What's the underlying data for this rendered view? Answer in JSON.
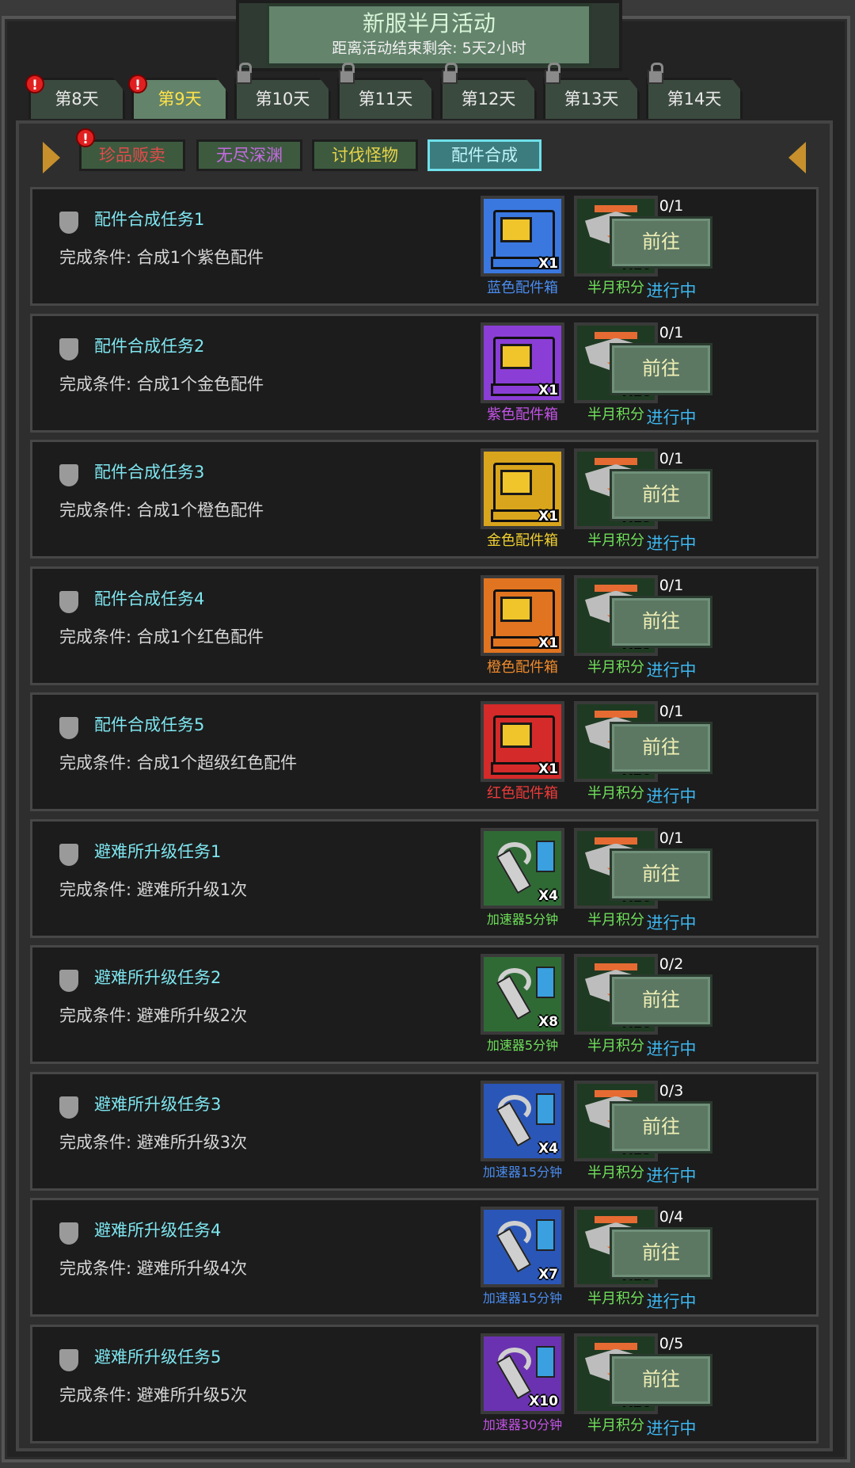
{
  "header": {
    "title": "新服半月活动",
    "countdown": "距离活动结束剩余: 5天2小时"
  },
  "day_tabs": [
    {
      "label": "第8天",
      "alert": "!",
      "locked": false,
      "active": false
    },
    {
      "label": "第9天",
      "alert": "!",
      "locked": false,
      "active": true
    },
    {
      "label": "第10天",
      "locked": true,
      "active": false
    },
    {
      "label": "第11天",
      "locked": true,
      "active": false
    },
    {
      "label": "第12天",
      "locked": true,
      "active": false
    },
    {
      "label": "第13天",
      "locked": true,
      "active": false
    },
    {
      "label": "第14天",
      "locked": true,
      "active": false
    }
  ],
  "sub_tabs": [
    {
      "label": "珍品贩卖",
      "alert": "!",
      "color": "#e34b4b",
      "bg": "#3d5a3f",
      "active": false
    },
    {
      "label": "无尽深渊",
      "color": "#c46be0",
      "bg": "#3d5a3f",
      "active": false
    },
    {
      "label": "讨伐怪物",
      "color": "#e8d44a",
      "bg": "#3d5a3f",
      "active": false
    },
    {
      "label": "配件合成",
      "color": "#a5e9f0",
      "bg": "#3c7b7e",
      "active": true
    }
  ],
  "tasks": [
    {
      "name": "配件合成任务1",
      "condition": "完成条件: 合成1个紫色配件",
      "reward1": {
        "label": "蓝色配件箱",
        "qty": "X1",
        "type": "crate",
        "color": "#3a78e0",
        "labelColor": "#4a8cf0"
      },
      "reward2": {
        "label": "半月积分",
        "qty": "X10",
        "labelColor": "#6ee05a"
      },
      "progress": "0/1",
      "button": "前往",
      "status": "进行中"
    },
    {
      "name": "配件合成任务2",
      "condition": "完成条件: 合成1个金色配件",
      "reward1": {
        "label": "紫色配件箱",
        "qty": "X1",
        "type": "crate",
        "color": "#8a3ed6",
        "labelColor": "#c453e8"
      },
      "reward2": {
        "label": "半月积分",
        "qty": "X10",
        "labelColor": "#6ee05a"
      },
      "progress": "0/1",
      "button": "前往",
      "status": "进行中"
    },
    {
      "name": "配件合成任务3",
      "condition": "完成条件: 合成1个橙色配件",
      "reward1": {
        "label": "金色配件箱",
        "qty": "X1",
        "type": "crate",
        "color": "#d9a51c",
        "labelColor": "#f0d030"
      },
      "reward2": {
        "label": "半月积分",
        "qty": "X15",
        "labelColor": "#6ee05a"
      },
      "progress": "0/1",
      "button": "前往",
      "status": "进行中"
    },
    {
      "name": "配件合成任务4",
      "condition": "完成条件: 合成1个红色配件",
      "reward1": {
        "label": "橙色配件箱",
        "qty": "X1",
        "type": "crate",
        "color": "#e07420",
        "labelColor": "#f08a2a"
      },
      "reward2": {
        "label": "半月积分",
        "qty": "X15",
        "labelColor": "#6ee05a"
      },
      "progress": "0/1",
      "button": "前往",
      "status": "进行中"
    },
    {
      "name": "配件合成任务5",
      "condition": "完成条件: 合成1个超级红色配件",
      "reward1": {
        "label": "红色配件箱",
        "qty": "X1",
        "type": "crate",
        "color": "#d42a2a",
        "labelColor": "#f03a3a"
      },
      "reward2": {
        "label": "半月积分",
        "qty": "X20",
        "labelColor": "#6ee05a"
      },
      "progress": "0/1",
      "button": "前往",
      "status": "进行中"
    },
    {
      "name": "避难所升级任务1",
      "condition": "完成条件: 避难所升级1次",
      "reward1": {
        "label": "加速器5分钟",
        "qty": "X4",
        "type": "wrench",
        "color": "#2f6a35",
        "labelColor": "#6ee05a"
      },
      "reward2": {
        "label": "半月积分",
        "qty": "X10",
        "labelColor": "#6ee05a"
      },
      "progress": "0/1",
      "button": "前往",
      "status": "进行中"
    },
    {
      "name": "避难所升级任务2",
      "condition": "完成条件: 避难所升级2次",
      "reward1": {
        "label": "加速器5分钟",
        "qty": "X8",
        "type": "wrench",
        "color": "#2f6a35",
        "labelColor": "#6ee05a"
      },
      "reward2": {
        "label": "半月积分",
        "qty": "X10",
        "labelColor": "#6ee05a"
      },
      "progress": "0/2",
      "button": "前往",
      "status": "进行中"
    },
    {
      "name": "避难所升级任务3",
      "condition": "完成条件: 避难所升级3次",
      "reward1": {
        "label": "加速器15分钟",
        "qty": "X4",
        "type": "wrench",
        "color": "#2a56b8",
        "labelColor": "#4a8cf0"
      },
      "reward2": {
        "label": "半月积分",
        "qty": "X15",
        "labelColor": "#6ee05a"
      },
      "progress": "0/3",
      "button": "前往",
      "status": "进行中"
    },
    {
      "name": "避难所升级任务4",
      "condition": "完成条件: 避难所升级4次",
      "reward1": {
        "label": "加速器15分钟",
        "qty": "X7",
        "type": "wrench",
        "color": "#2a56b8",
        "labelColor": "#4a8cf0"
      },
      "reward2": {
        "label": "半月积分",
        "qty": "X15",
        "labelColor": "#6ee05a"
      },
      "progress": "0/4",
      "button": "前往",
      "status": "进行中"
    },
    {
      "name": "避难所升级任务5",
      "condition": "完成条件: 避难所升级5次",
      "reward1": {
        "label": "加速器30分钟",
        "qty": "X10",
        "type": "wrench",
        "color": "#6a32b0",
        "labelColor": "#c453e8"
      },
      "reward2": {
        "label": "半月积分",
        "qty": "X20",
        "labelColor": "#6ee05a"
      },
      "progress": "0/5",
      "button": "前往",
      "status": "进行中"
    }
  ],
  "colors": {
    "task_name": "#7ee6f0",
    "status": "#3db7f0",
    "button_bg": "#5c7863",
    "button_text": "#f1f0b6"
  }
}
